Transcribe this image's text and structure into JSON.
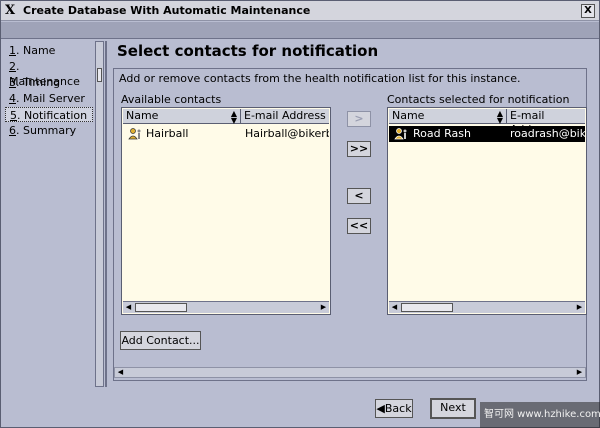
{
  "window": {
    "title": "Create Database With Automatic Maintenance",
    "close_label": "X"
  },
  "nav": {
    "items": [
      {
        "num": "1",
        "label": "Name"
      },
      {
        "num": "2",
        "label": "Maintenance"
      },
      {
        "num": "3",
        "label": "Timing"
      },
      {
        "num": "4",
        "label": "Mail Server"
      },
      {
        "num": "5",
        "label": "Notification"
      },
      {
        "num": "6",
        "label": "Summary"
      }
    ],
    "selected_index": 4
  },
  "page": {
    "heading": "Select contacts for notification",
    "description": "Add or remove contacts from the health notification list for this instance."
  },
  "available": {
    "label": "Available contacts",
    "columns": [
      "Name",
      "E-mail Address"
    ],
    "rows": [
      {
        "name": "Hairball",
        "email": "Hairball@bikerbc"
      }
    ]
  },
  "selected": {
    "label": "Contacts selected for notification",
    "columns": [
      "Name",
      "E-mail Address"
    ],
    "rows": [
      {
        "name": "Road Rash",
        "email": "roadrash@bike"
      }
    ]
  },
  "move_buttons": {
    "add": ">",
    "add_all": ">>",
    "remove": "<",
    "remove_all": "<<"
  },
  "add_contact_label": "Add Contact...",
  "footer": {
    "back_label": "Back",
    "next_label": "Next"
  },
  "watermark": "智可网 www.hzhike.com",
  "colors": {
    "window_bg": "#b9bdd1",
    "list_bg": "#fffbe8",
    "selected_row": "#000000"
  }
}
